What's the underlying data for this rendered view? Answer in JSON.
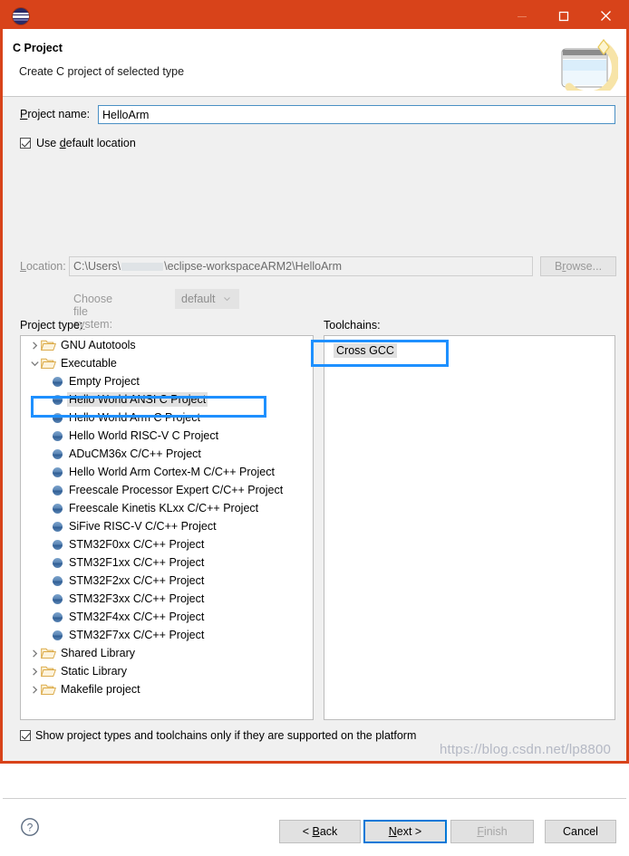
{
  "window": {
    "logo_icon": "eclipse-logo-icon",
    "controls": [
      {
        "name": "minimize-button",
        "icon": "minimize-icon",
        "label": "—"
      },
      {
        "name": "maximize-button",
        "icon": "maximize-icon",
        "label": "□"
      },
      {
        "name": "close-button",
        "icon": "close-icon",
        "label": "✕"
      }
    ],
    "titlebar_color": "#d8431a",
    "border_color": "#d8431a"
  },
  "banner": {
    "title": "C Project",
    "subtitle": "Create C project of selected type",
    "art_icon": "new-c-project-wizard-icon"
  },
  "form": {
    "project_name_label": "Project name:",
    "project_name_value": "HelloArm",
    "project_name_placeholder": "",
    "use_default_location_label": "Use default location",
    "use_default_location_checked": true,
    "location_label": "Location:",
    "location_prefix": "C:\\Users\\",
    "location_suffix": "\\eclipse-workspaceARM2\\HelloArm",
    "location_redacted": true,
    "browse_label": "Browse...",
    "browse_enabled": false,
    "file_system_label": "Choose file system:",
    "file_system_value": "default",
    "file_system_enabled": false
  },
  "project_type": {
    "label": "Project type:",
    "rows": [
      {
        "level": 0,
        "icon": "folder-icon",
        "twisty": "collapsed",
        "label": "GNU Autotools",
        "selected": false
      },
      {
        "level": 0,
        "icon": "folder-icon",
        "twisty": "expanded",
        "label": "Executable",
        "selected": false
      },
      {
        "level": 1,
        "icon": "sphere-icon",
        "twisty": "none",
        "label": "Empty Project",
        "selected": false
      },
      {
        "level": 1,
        "icon": "sphere-icon",
        "twisty": "none",
        "label": "Hello World ANSI C Project",
        "selected": true
      },
      {
        "level": 1,
        "icon": "sphere-icon",
        "twisty": "none",
        "label": "Hello World Arm C Project",
        "selected": false
      },
      {
        "level": 1,
        "icon": "sphere-icon",
        "twisty": "none",
        "label": "Hello World RISC-V C Project",
        "selected": false
      },
      {
        "level": 1,
        "icon": "sphere-icon",
        "twisty": "none",
        "label": "ADuCM36x C/C++ Project",
        "selected": false
      },
      {
        "level": 1,
        "icon": "sphere-icon",
        "twisty": "none",
        "label": "Hello World Arm Cortex-M C/C++ Project",
        "selected": false
      },
      {
        "level": 1,
        "icon": "sphere-icon",
        "twisty": "none",
        "label": "Freescale Processor Expert C/C++ Project",
        "selected": false
      },
      {
        "level": 1,
        "icon": "sphere-icon",
        "twisty": "none",
        "label": "Freescale Kinetis KLxx C/C++ Project",
        "selected": false
      },
      {
        "level": 1,
        "icon": "sphere-icon",
        "twisty": "none",
        "label": "SiFive RISC-V C/C++ Project",
        "selected": false
      },
      {
        "level": 1,
        "icon": "sphere-icon",
        "twisty": "none",
        "label": "STM32F0xx C/C++ Project",
        "selected": false
      },
      {
        "level": 1,
        "icon": "sphere-icon",
        "twisty": "none",
        "label": "STM32F1xx C/C++ Project",
        "selected": false
      },
      {
        "level": 1,
        "icon": "sphere-icon",
        "twisty": "none",
        "label": "STM32F2xx C/C++ Project",
        "selected": false
      },
      {
        "level": 1,
        "icon": "sphere-icon",
        "twisty": "none",
        "label": "STM32F3xx C/C++ Project",
        "selected": false
      },
      {
        "level": 1,
        "icon": "sphere-icon",
        "twisty": "none",
        "label": "STM32F4xx C/C++ Project",
        "selected": false
      },
      {
        "level": 1,
        "icon": "sphere-icon",
        "twisty": "none",
        "label": "STM32F7xx C/C++ Project",
        "selected": false
      },
      {
        "level": 0,
        "icon": "folder-icon",
        "twisty": "collapsed",
        "label": "Shared Library",
        "selected": false
      },
      {
        "level": 0,
        "icon": "folder-icon",
        "twisty": "collapsed",
        "label": "Static Library",
        "selected": false
      },
      {
        "level": 0,
        "icon": "folder-icon",
        "twisty": "collapsed",
        "label": "Makefile project",
        "selected": false
      }
    ]
  },
  "toolchains": {
    "label": "Toolchains:",
    "items": [
      {
        "label": "Cross GCC",
        "selected": true
      }
    ]
  },
  "show_only": {
    "label": "Show project types and toolchains only if they are supported on the platform",
    "checked": true
  },
  "buttons": {
    "help_icon": "help-question-icon",
    "back": {
      "pre": "< ",
      "mnemonic": "B",
      "post": "ack",
      "enabled": true,
      "focused": false
    },
    "next": {
      "pre": "",
      "mnemonic": "N",
      "post": "ext >",
      "enabled": true,
      "focused": true
    },
    "finish": {
      "pre": "",
      "mnemonic": "F",
      "post": "inish",
      "enabled": false,
      "focused": false
    },
    "cancel": {
      "pre": "",
      "mnemonic": "",
      "post": "Cancel",
      "enabled": true,
      "focused": false
    }
  },
  "annotations": {
    "color": "#1e90ff",
    "boxes": [
      "hello-world-ansi-c-project",
      "cross-gcc"
    ]
  },
  "watermark": {
    "text": "https://blog.csdn.net/lp8800"
  }
}
